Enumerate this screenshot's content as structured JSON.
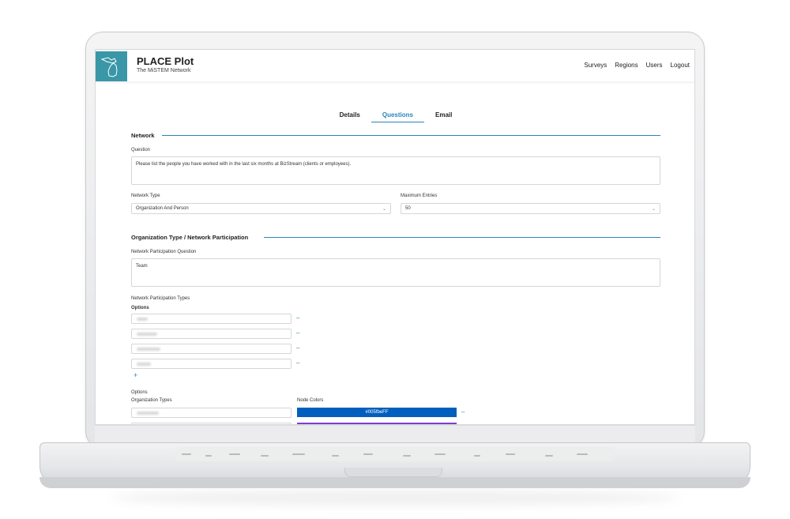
{
  "app": {
    "title": "PLACE Plot",
    "subtitle": "The MiSTEM Network",
    "nav": [
      "Surveys",
      "Regions",
      "Users",
      "Logout"
    ]
  },
  "tabs": [
    {
      "label": "Details",
      "active": false
    },
    {
      "label": "Questions",
      "active": true
    },
    {
      "label": "Email",
      "active": false
    }
  ],
  "network": {
    "heading": "Network",
    "question_label": "Question",
    "question_value": "Please list the people you have worked with in the last six months at BizStream (clients or employees).",
    "network_type_label": "Network Type",
    "network_type_value": "Organization And Person",
    "max_entries_label": "Maximum Entries",
    "max_entries_value": "50"
  },
  "participation": {
    "heading": "Organization Type / Network Participation",
    "question_label": "Network Participation Question",
    "question_value": "Team",
    "types_label": "Network Participation Types",
    "options_label": "Options",
    "option_count": 4
  },
  "organization": {
    "options_label": "Options",
    "types_label": "Organization Types",
    "node_colors_label": "Node Colors",
    "node_color_value": "#005fbeFF",
    "node_color_hex": "#005fbe",
    "second_color_hex": "#7b3fd0"
  },
  "colors": {
    "accent": "#2b84b8",
    "logo": "#3a97a7"
  }
}
